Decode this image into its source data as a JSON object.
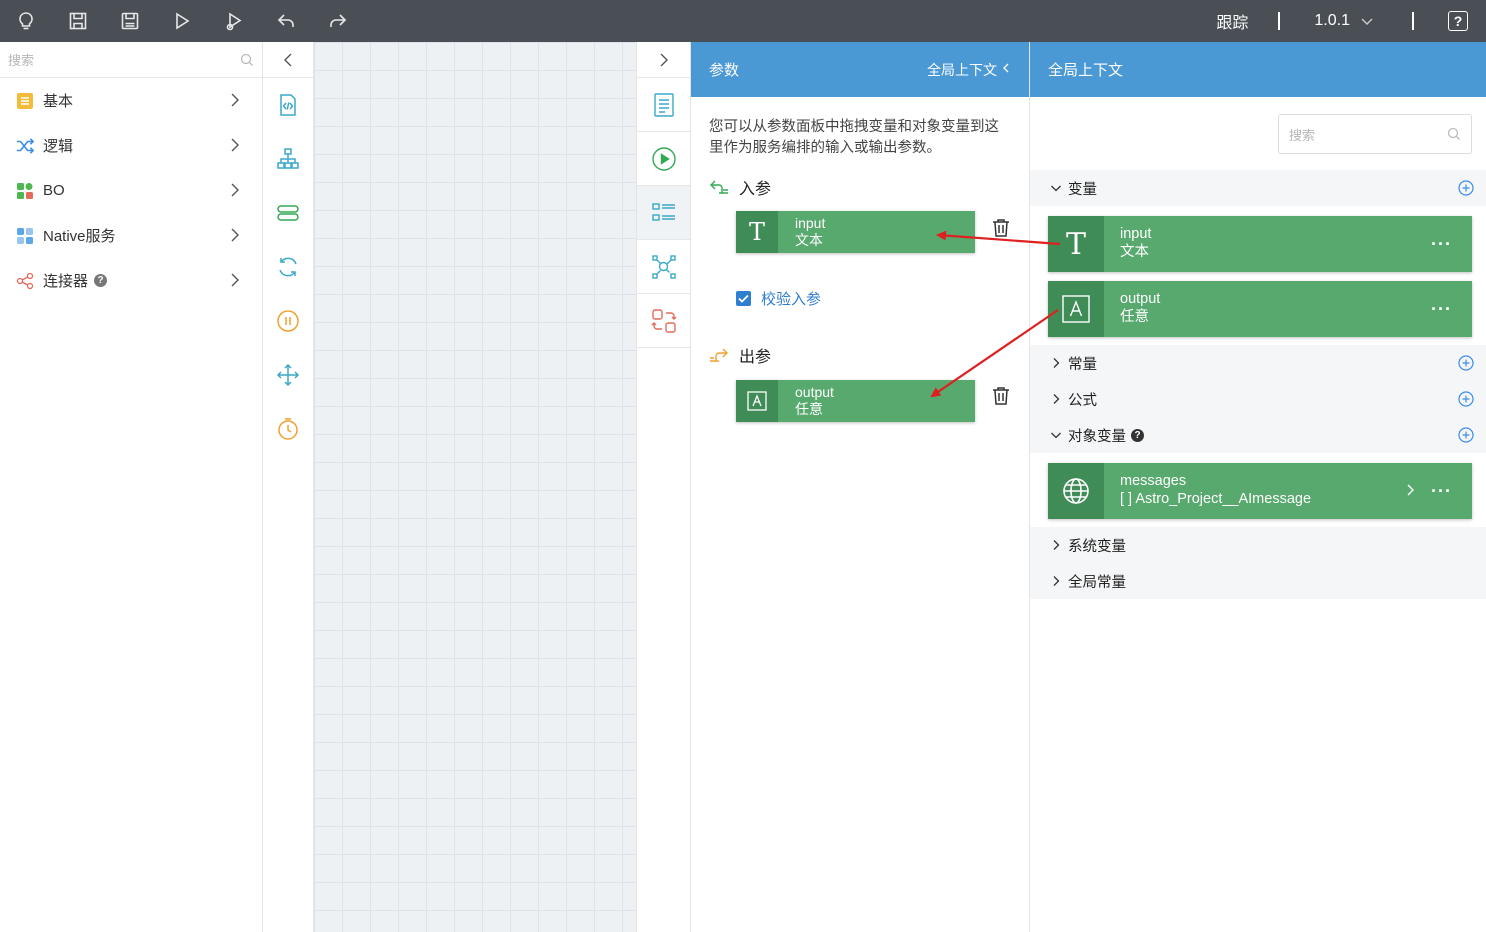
{
  "toolbar": {
    "icons": [
      "bulb-icon",
      "save-icon",
      "save-as-icon",
      "run-icon",
      "debug-icon",
      "undo-icon",
      "redo-icon"
    ],
    "trace_label": "跟踪",
    "version": "1.0.1",
    "help_label": "?"
  },
  "left_panel": {
    "search_placeholder": "搜索",
    "items": [
      {
        "label": "基本",
        "icon": "basic-icon"
      },
      {
        "label": "逻辑",
        "icon": "shuffle-icon"
      },
      {
        "label": "BO",
        "icon": "bo-icon"
      },
      {
        "label": "Native服务",
        "icon": "native-icon"
      },
      {
        "label": "连接器",
        "icon": "share-icon",
        "help": "?"
      }
    ]
  },
  "params_panel": {
    "title": "参数",
    "global_link": "全局上下文",
    "description": "您可以从参数面板中拖拽变量和对象变量到这里作为服务编排的输入或输出参数。",
    "input_section": "入参",
    "input_param": {
      "name": "input",
      "type": "文本"
    },
    "validate_label": "校验入参",
    "output_section": "出参",
    "output_param": {
      "name": "output",
      "type": "任意"
    }
  },
  "global_panel": {
    "title": "全局上下文",
    "search_placeholder": "搜索",
    "groups": {
      "variables": "变量",
      "constants": "常量",
      "formula": "公式",
      "object_variables": "对象变量",
      "object_help": "?",
      "system_variables": "系统变量",
      "global_constants": "全局常量"
    },
    "variables": [
      {
        "name": "input",
        "type": "文本",
        "more": "···"
      },
      {
        "name": "output",
        "type": "任意",
        "more": "···"
      }
    ],
    "object_variables": [
      {
        "name": "messages",
        "type": "[ ] Astro_Project__AImessage",
        "more": "···"
      }
    ]
  },
  "colors": {
    "toolbar_bg": "#4a4f56",
    "panel_header": "#4a98d4",
    "card_green": "#57a96e",
    "card_icon_green": "#3f8c57",
    "arrow_red": "#e02020"
  }
}
